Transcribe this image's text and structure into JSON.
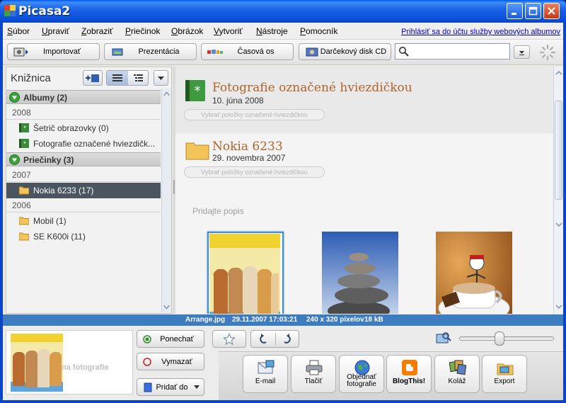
{
  "window": {
    "title": "Picasa2",
    "controls": [
      "minimize",
      "maximize",
      "close"
    ]
  },
  "menu": {
    "items": [
      "Súbor",
      "Upraviť",
      "Zobraziť",
      "Priečinok",
      "Obrázok",
      "Vytvoriť",
      "Nástroje",
      "Pomocník"
    ],
    "signin_link": "Prihlásiť sa do účtu služby webových albumov"
  },
  "toolbar": {
    "import": "Importovať",
    "slideshow": "Prezentácia",
    "timeline": "Časová os",
    "giftcd": "Darčekový disk CD",
    "search_value": ""
  },
  "library": {
    "title": "Knižnica",
    "groups": [
      {
        "label": "Albumy (2)",
        "years": [
          {
            "year": "2008",
            "items": [
              "Šetrič obrazovky (0)",
              "Fotografie označené hviezdičk..."
            ]
          }
        ]
      },
      {
        "label": "Priečinky (3)",
        "years": [
          {
            "year": "2007",
            "items": [
              "Nokia 6233 (17)"
            ]
          },
          {
            "year": "2006",
            "items": [
              "Mobil (1)",
              "SE K600i (11)"
            ]
          }
        ]
      }
    ],
    "selected_item": "Nokia 6233 (17)"
  },
  "albums": [
    {
      "title": "Fotografie označené hviezdičkou",
      "date": "10. júna 2008",
      "select_label": "Vybrať položky označené hviezdičkou"
    },
    {
      "title": "Nokia 6233",
      "date": "29. novembra 2007",
      "select_label": "Vybrať položky označené hviezdičkou",
      "caption_placeholder": "Pridajte popis",
      "thumbnails": [
        "bottles",
        "stones",
        "coffee"
      ]
    }
  ],
  "status": {
    "filename": "Arrange.jpg",
    "datetime": "29.11.2007 17:03:21",
    "dimensions": "240 x 320 pixelov",
    "size": "18 kB"
  },
  "tray": {
    "preview_text": "na fotografie",
    "keep": "Ponechať",
    "remove": "Vymazať",
    "add_to": "Pridať do",
    "zoom_level": 0.42,
    "actions": [
      {
        "label": "E-mail",
        "icon": "email-icon"
      },
      {
        "label": "Tlačiť",
        "icon": "printer-icon"
      },
      {
        "label": "Objednať fotografie",
        "icon": "globe-icon"
      },
      {
        "label": "BlogThis!",
        "icon": "blogger-icon"
      },
      {
        "label": "Koláž",
        "icon": "collage-icon"
      },
      {
        "label": "Export",
        "icon": "export-icon"
      }
    ]
  },
  "colors": {
    "title_bar": "#0B4FD9",
    "selection": "#4A5560",
    "album_title": "#B2622A",
    "status_bar": "#3E7CC0",
    "link": "#0000CC"
  }
}
